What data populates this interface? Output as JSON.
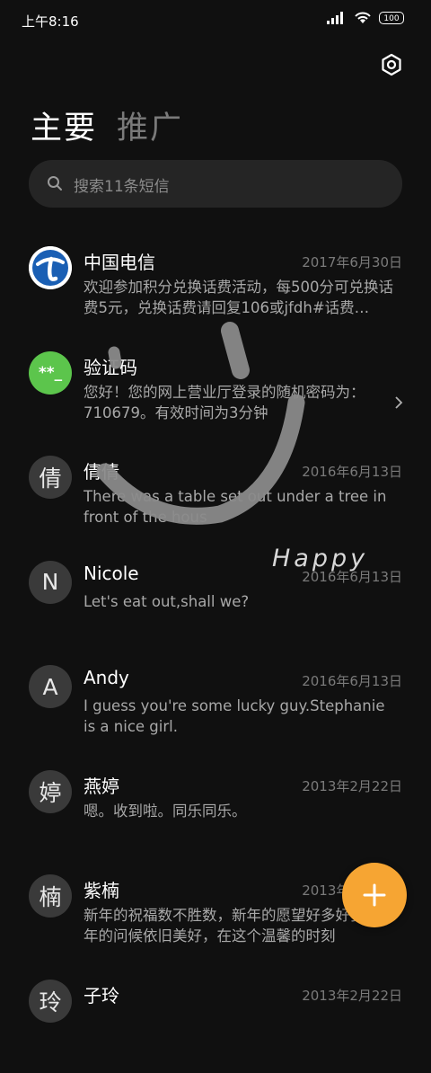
{
  "status_bar": {
    "time": "上午8:16",
    "battery": "100"
  },
  "tabs": [
    {
      "label": "主要"
    },
    {
      "label": "推广"
    }
  ],
  "search": {
    "placeholder": "搜索11条短信"
  },
  "messages": [
    {
      "name": "中国电信",
      "date": "2017年6月30日",
      "preview": "欢迎参加积分兑换话费活动，每500分可兑换话费5元，兑换话费请回复106或jfdh#话费…",
      "avatar_text": ""
    },
    {
      "name": "验证码",
      "date": "",
      "preview": "您好！您的网上营业厅登录的随机密码为：710679。有效时间为3分钟",
      "avatar_text": "**_"
    },
    {
      "name": "倩倩",
      "date": "2016年6月13日",
      "preview": "There was a table set out under a tree in front of the hous",
      "avatar_text": "倩"
    },
    {
      "name": "Nicole",
      "date": "2016年6月13日",
      "preview": "Let's eat out,shall we?",
      "avatar_text": "N"
    },
    {
      "name": "Andy",
      "date": "2016年6月13日",
      "preview": "I guess you're some lucky guy.Stephanie is a nice girl.",
      "avatar_text": "A"
    },
    {
      "name": "燕婷",
      "date": "2013年2月22日",
      "preview": "嗯。收到啦。同乐同乐。",
      "avatar_text": "婷"
    },
    {
      "name": "紫楠",
      "date": "2013年2月22日",
      "preview": "新年的祝福数不胜数，新年的愿望好多好多，新年的问候依旧美好，在这个温馨的时刻",
      "avatar_text": "楠"
    },
    {
      "name": "子玲",
      "date": "2013年2月22日",
      "preview": "",
      "avatar_text": "玲"
    }
  ],
  "doodle_text": "Happy",
  "colors": {
    "background": "#101010",
    "fab": "#f6a533",
    "verify_avatar": "#5cc54c",
    "telecom_blue": "#1a5fb4"
  }
}
